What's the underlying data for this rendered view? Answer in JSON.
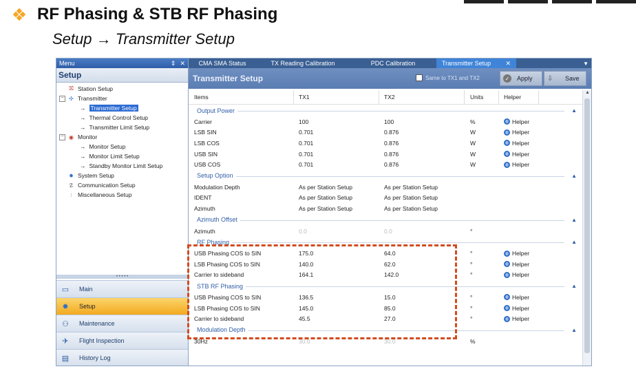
{
  "slide": {
    "title": "RF Phasing & STB RF Phasing",
    "subtitle": "Setup → Transmitter Setup"
  },
  "menu": {
    "label": "Menu",
    "pin_glyph": "⇕",
    "close_glyph": "✕",
    "setup_heading": "Setup"
  },
  "tree": {
    "station_setup": "Station Setup",
    "transmitter": "Transmitter",
    "transmitter_setup": "Transmitter Setup",
    "thermal_control_setup": "Thermal Control Setup",
    "transmitter_limit_setup": "Transmitter Limit Setup",
    "monitor": "Monitor",
    "monitor_setup": "Monitor Setup",
    "monitor_limit_setup": "Monitor Limit Setup",
    "standby_monitor_limit_setup": "Standby Monitor Limit Setup",
    "system_setup": "System Setup",
    "communication_setup": "Communication Setup",
    "miscellaneous_setup": "Miscellaneous Setup"
  },
  "nav": {
    "main": "Main",
    "setup": "Setup",
    "maintenance": "Maintenance",
    "flight_inspection": "Flight Inspection",
    "history_log": "History Log"
  },
  "tabs": {
    "cma_sma_status": "CMA SMA Status",
    "tx_reading_calibration": "TX Reading Calibration",
    "pdc_calibration": "PDC Calibration",
    "transmitter_setup": "Transmitter Setup"
  },
  "toolbar": {
    "title": "Transmitter Setup",
    "same_to_label": "Same to TX1 and TX2",
    "apply_label": "Apply",
    "save_label": "Save"
  },
  "grid": {
    "headers": {
      "items": "Items",
      "tx1": "TX1",
      "tx2": "TX2",
      "units": "Units",
      "helper": "Helper"
    },
    "helper_label": "Helper",
    "output_power": {
      "title": "Output Power",
      "rows": [
        {
          "item": "Carrier",
          "tx1": "100",
          "tx2": "100",
          "unit": "%"
        },
        {
          "item": "LSB SIN",
          "tx1": "0.701",
          "tx2": "0.876",
          "unit": "W"
        },
        {
          "item": "LSB COS",
          "tx1": "0.701",
          "tx2": "0.876",
          "unit": "W"
        },
        {
          "item": "USB SIN",
          "tx1": "0.701",
          "tx2": "0.876",
          "unit": "W"
        },
        {
          "item": "USB COS",
          "tx1": "0.701",
          "tx2": "0.876",
          "unit": "W"
        }
      ]
    },
    "setup_option": {
      "title": "Setup Option",
      "rows": [
        {
          "item": "Modulation Depth",
          "tx1": "As per Station Setup",
          "tx2": "As per Station Setup"
        },
        {
          "item": "IDENT",
          "tx1": "As per Station Setup",
          "tx2": "As per Station Setup"
        },
        {
          "item": "Azimuth",
          "tx1": "As per Station Setup",
          "tx2": "As per Station Setup"
        }
      ]
    },
    "azimuth_offset": {
      "title": "Azimuth Offset",
      "rows": [
        {
          "item": "Azimuth",
          "tx1": "0.0",
          "tx2": "0.0",
          "unit": "°"
        }
      ]
    },
    "rf_phasing": {
      "title": "RF Phasing",
      "rows": [
        {
          "item": "USB Phasing COS to SIN",
          "tx1": "175.0",
          "tx2": "64.0",
          "unit": "°"
        },
        {
          "item": "LSB Phasing COS to SIN",
          "tx1": "140.0",
          "tx2": "62.0",
          "unit": "°"
        },
        {
          "item": "Carrier to sideband",
          "tx1": "164.1",
          "tx2": "142.0",
          "unit": "°"
        }
      ]
    },
    "stb_rf_phasing": {
      "title": "STB RF Phasing",
      "rows": [
        {
          "item": "USB Phasing COS to SIN",
          "tx1": "136.5",
          "tx2": "15.0",
          "unit": "°"
        },
        {
          "item": "LSB Phasing COS to SIN",
          "tx1": "145.0",
          "tx2": "85.0",
          "unit": "°"
        },
        {
          "item": "Carrier to sideband",
          "tx1": "45.5",
          "tx2": "27.0",
          "unit": "°"
        }
      ]
    },
    "modulation_depth": {
      "title": "Modulation Depth",
      "rows": [
        {
          "item": "30Hz",
          "tx1": "30.0",
          "tx2": "30.0",
          "unit": "%"
        }
      ]
    }
  }
}
